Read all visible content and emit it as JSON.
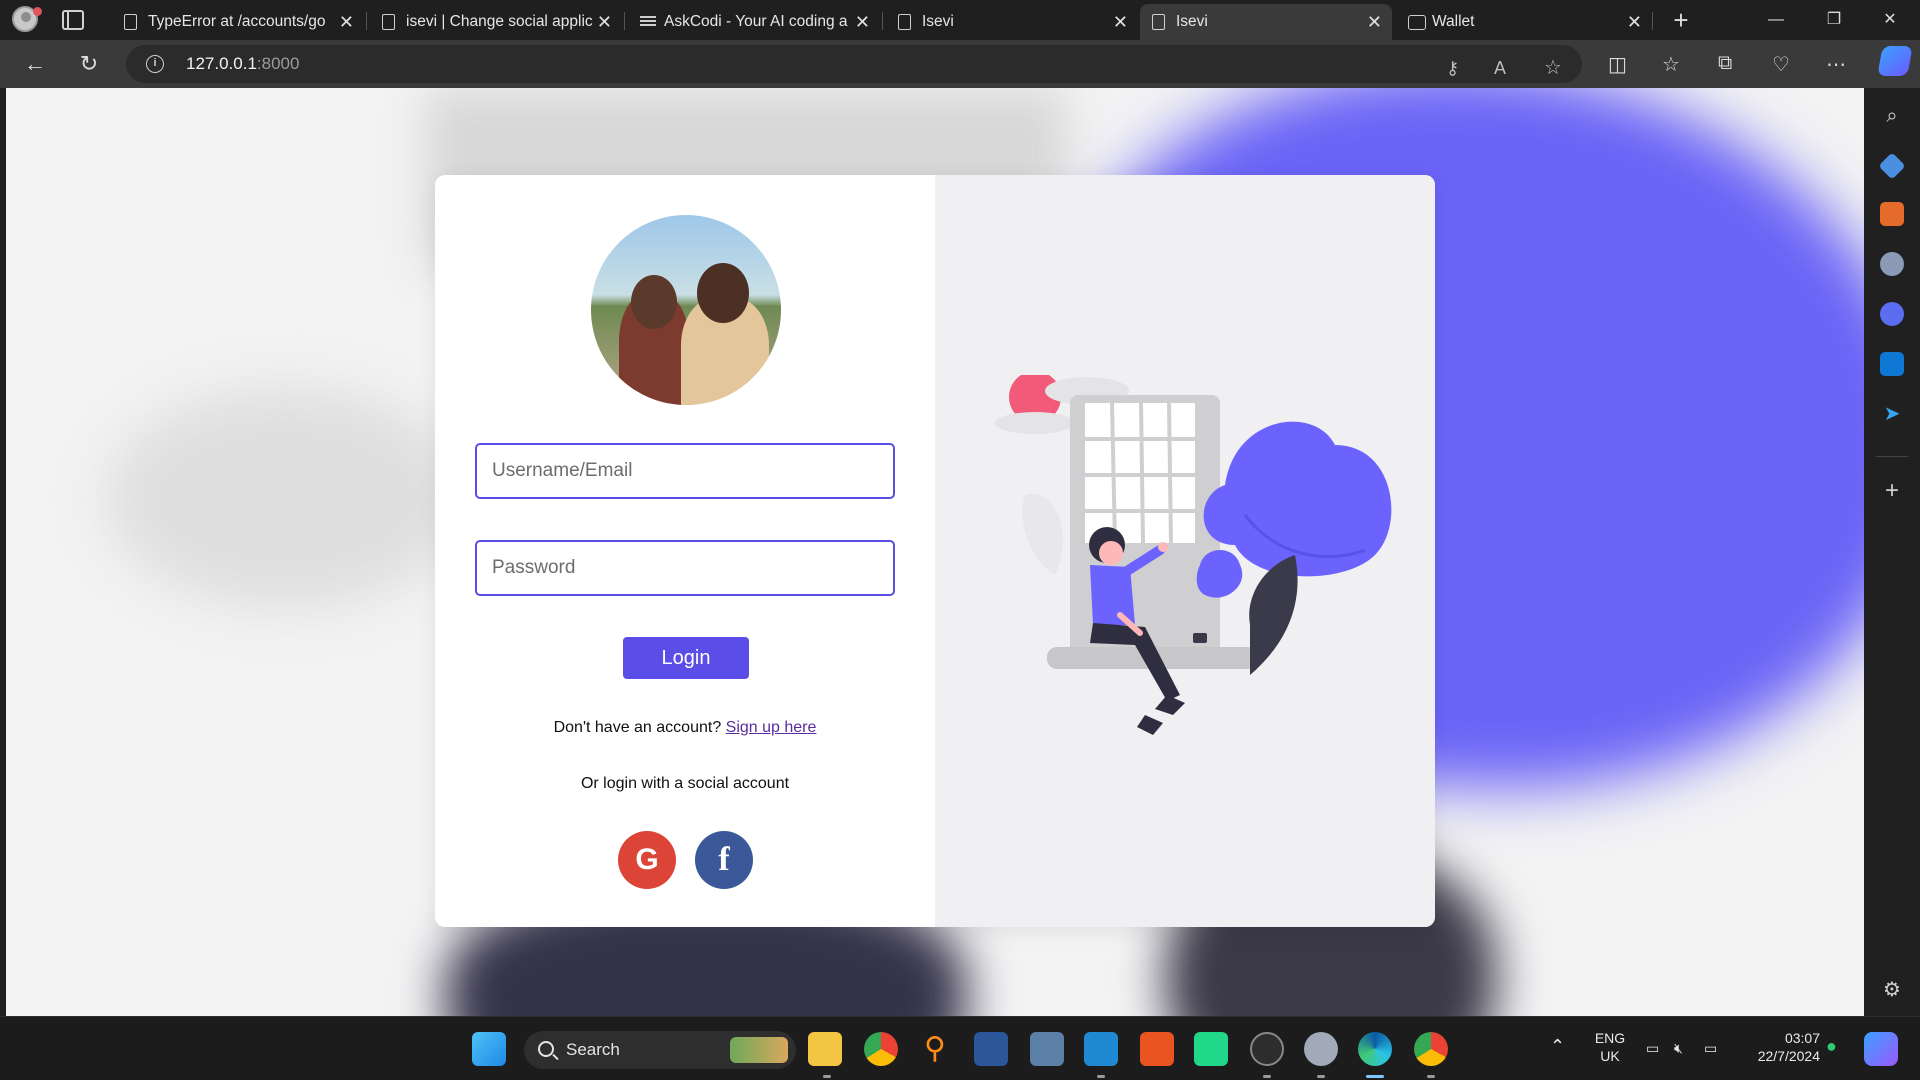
{
  "browser": {
    "tabs": [
      {
        "title": "TypeError at /accounts/go",
        "icon": "page-icon"
      },
      {
        "title": "isevi | Change social applic",
        "icon": "page-icon"
      },
      {
        "title": "AskCodi - Your AI coding a",
        "icon": "askcodi-icon"
      },
      {
        "title": "Isevi",
        "icon": "page-icon"
      },
      {
        "title": "Isevi",
        "icon": "page-icon",
        "active": true
      },
      {
        "title": "Wallet",
        "icon": "wallet-icon"
      }
    ],
    "address": {
      "host": "127.0.0.1",
      "port": ":8000"
    }
  },
  "login": {
    "username_placeholder": "Username/Email",
    "password_placeholder": "Password",
    "login_label": "Login",
    "signup_prompt": "Don't have an account?",
    "signup_link": "Sign up here",
    "social_text": "Or login with a social account",
    "google_glyph": "G",
    "facebook_glyph": "f"
  },
  "taskbar": {
    "search_label": "Search",
    "language": "ENG",
    "region": "UK",
    "time": "03:07",
    "date": "22/7/2024"
  },
  "colors": {
    "accent": "#5b4ee8",
    "google": "#db4437",
    "facebook": "#3b5998",
    "illustration_purple": "#6c63ff",
    "illustration_pink": "#f25a7a"
  }
}
